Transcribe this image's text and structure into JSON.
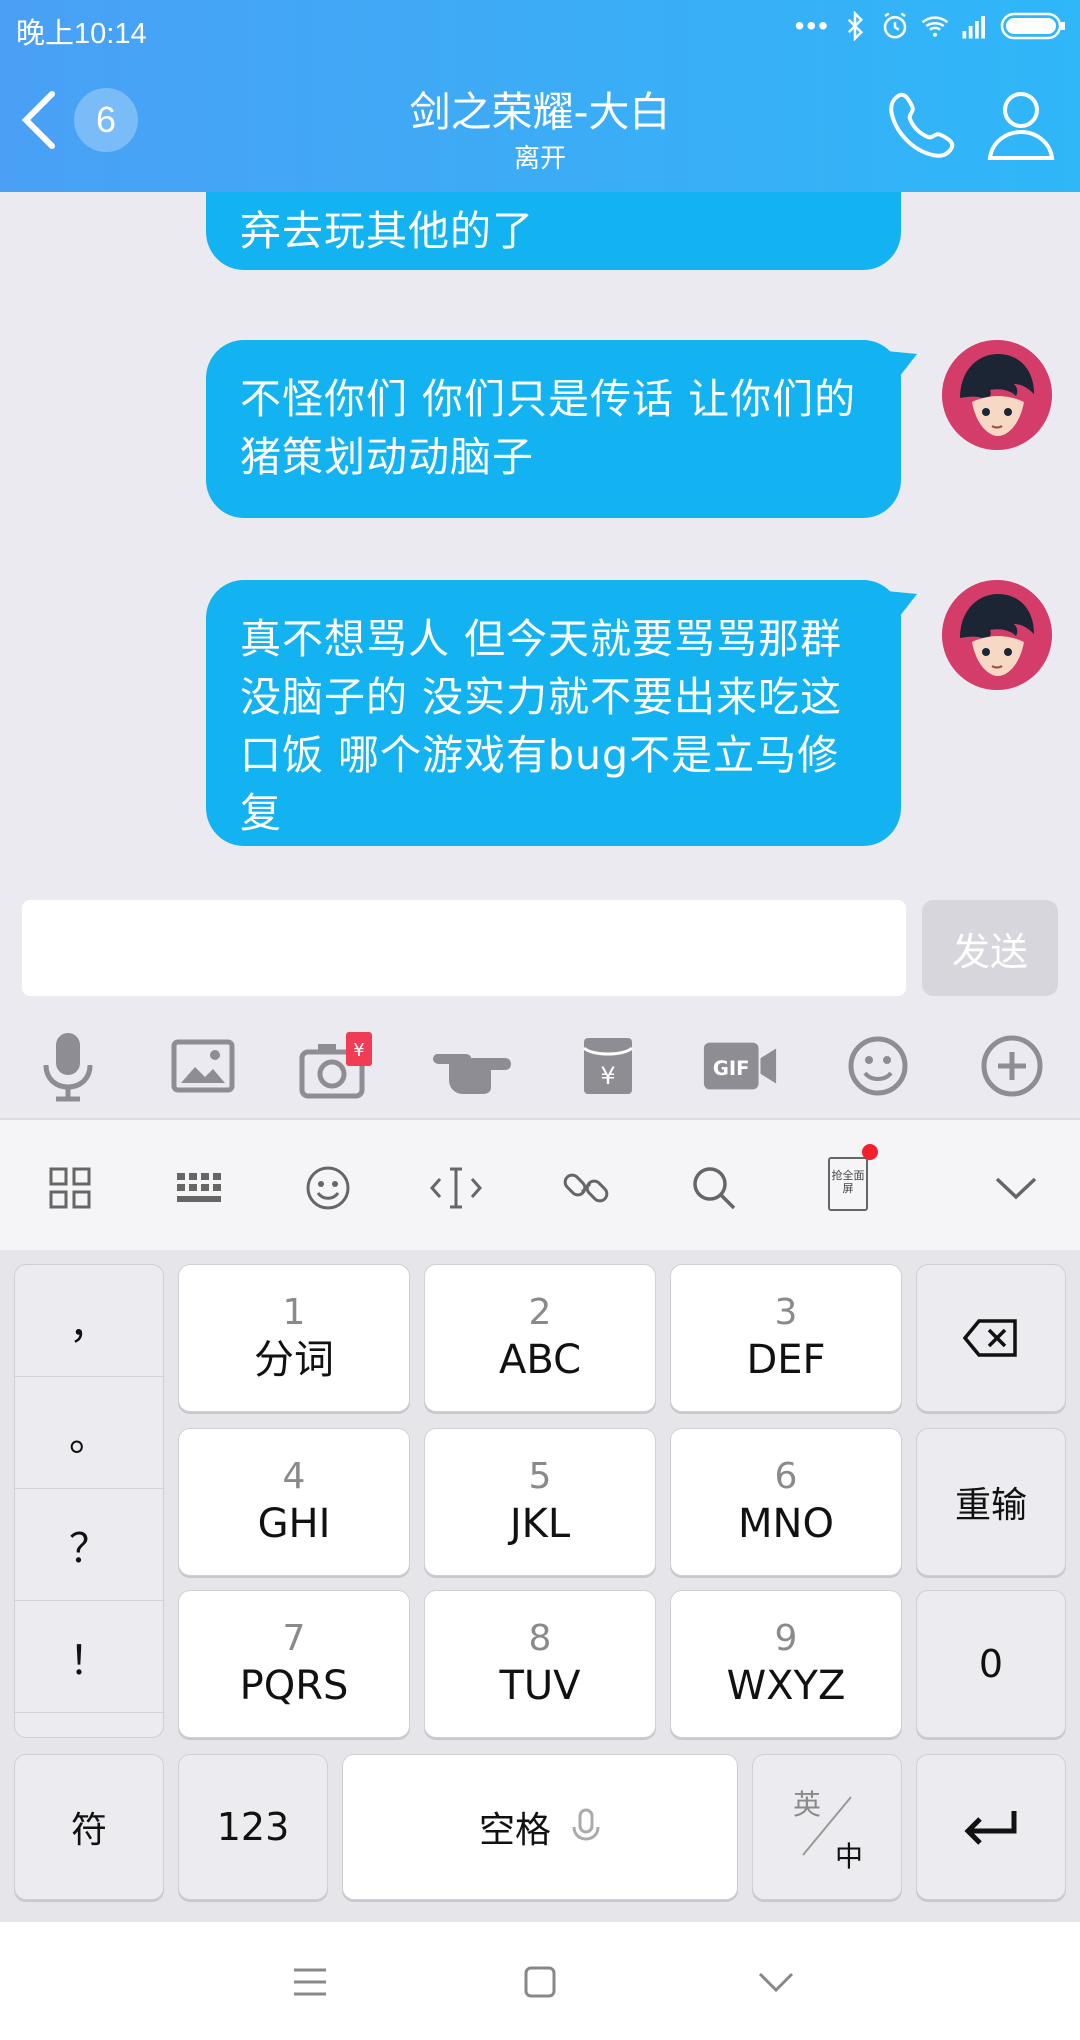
{
  "status_bar": {
    "time": "晚上10:14"
  },
  "header": {
    "unread_count": "6",
    "title": "剑之荣耀-大白",
    "subtitle": "离开"
  },
  "messages": [
    {
      "text": "弃去玩其他的了",
      "sender": "self"
    },
    {
      "text": "不怪你们  你们只是传话  让你们的猪策划动动脑子",
      "sender": "self"
    },
    {
      "text": "真不想骂人  但今天就要骂骂那群没脑子的 没实力就不要出来吃这口饭  哪个游戏有bug不是立马修复",
      "sender": "self"
    }
  ],
  "input": {
    "value": "",
    "placeholder": ""
  },
  "send_label": "发送",
  "toolbar_icons": [
    "mic-icon",
    "image-icon",
    "camera-icon",
    "poke-icon",
    "red-packet-icon",
    "gif-icon",
    "emoji-icon",
    "plus-icon"
  ],
  "keyboard_top_icons": [
    "apps-icon",
    "keyboard-layout-icon",
    "emoji-icon",
    "cursor-icon",
    "link-icon",
    "search-icon",
    "fullscreen-promo-icon",
    "collapse-icon"
  ],
  "keyboard_promo_label": "抢全面屏",
  "keyboard": {
    "punctuation": [
      "，",
      "。",
      "？",
      "！"
    ],
    "keys": [
      {
        "num": "1",
        "letters": "分词"
      },
      {
        "num": "2",
        "letters": "ABC"
      },
      {
        "num": "3",
        "letters": "DEF"
      },
      {
        "num": "4",
        "letters": "GHI"
      },
      {
        "num": "5",
        "letters": "JKL"
      },
      {
        "num": "6",
        "letters": "MNO"
      },
      {
        "num": "7",
        "letters": "PQRS"
      },
      {
        "num": "8",
        "letters": "TUV"
      },
      {
        "num": "9",
        "letters": "WXYZ"
      }
    ],
    "reinput": "重输",
    "zero": "0",
    "symbols": "符",
    "numbers": "123",
    "space": "空格",
    "lang_en": "英",
    "lang_zh": "中"
  },
  "colors": {
    "header_start": "#4aa0f5",
    "header_end": "#2fb7f8",
    "bubble": "#13b3f2"
  }
}
